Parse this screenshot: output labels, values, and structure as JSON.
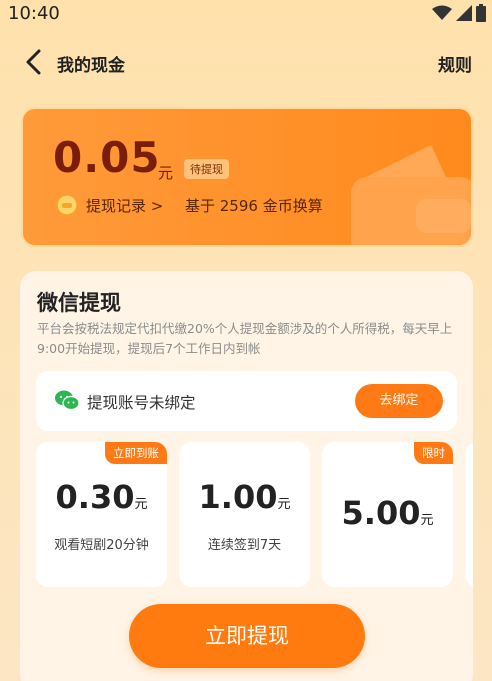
{
  "status_bar": {
    "time": "10:40"
  },
  "nav": {
    "title": "我的现金",
    "rules": "规则"
  },
  "balance": {
    "amount": "0.05",
    "unit": "元",
    "badge": "待提现",
    "records_link": "提现记录 >",
    "based_on": "基于 2596 金币换算"
  },
  "withdraw_section": {
    "title": "微信提现",
    "tax_note": "平台会按税法规定代扣代缴20%个人提现金额涉及的个人所得税，每天早上9:00开始提现，提现后7个工作日内到帐",
    "account_label": "提现账号未绑定",
    "bind_button": "去绑定",
    "options": [
      {
        "amount": "0.30",
        "unit": "元",
        "desc": "观看短剧20分钟",
        "tag": "立即到账"
      },
      {
        "amount": "1.00",
        "unit": "元",
        "desc": "连续签到7天",
        "tag": ""
      },
      {
        "amount": "5.00",
        "unit": "元",
        "desc": "",
        "tag": "限时"
      }
    ],
    "withdraw_button": "立即提现"
  },
  "colors": {
    "accent": "#ff7a14",
    "balance_text": "#7a1d0a",
    "background": "#fde3b6"
  },
  "icons": [
    "wifi-icon",
    "signal-icon",
    "battery-icon",
    "back-arrow-icon",
    "coin-icon",
    "wechat-icon",
    "wallet-icon"
  ]
}
